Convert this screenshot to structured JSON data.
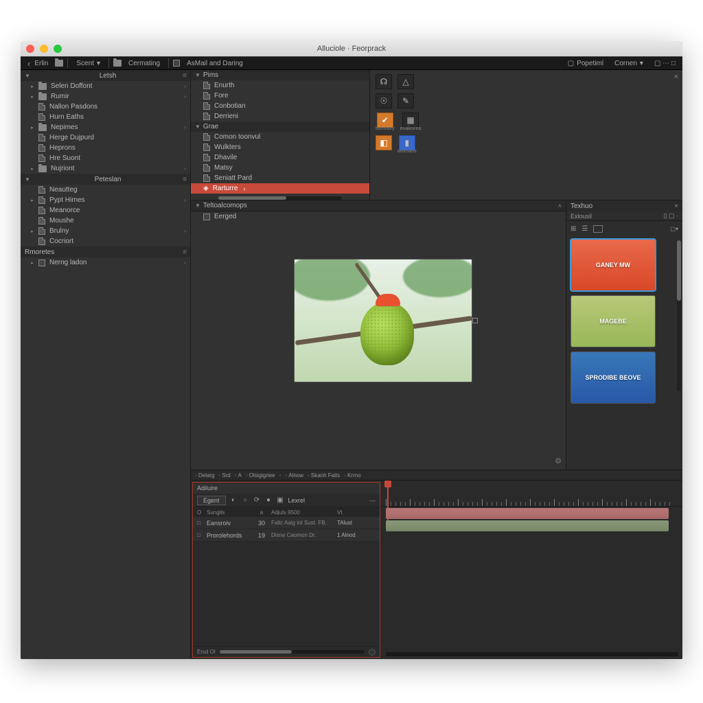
{
  "window_title": "Alluciole · Feorprack",
  "toolbar": {
    "back_label": "Erlin",
    "search_label": "Scent",
    "breadcrumb1": "Cermating",
    "breadcrumb2": "AsMail and Daring",
    "right1": "Popetiml",
    "right2": "Cornen"
  },
  "sidebar": {
    "sections": [
      {
        "title": "Letsh",
        "items": [
          {
            "label": "Selen Doffont",
            "icon": "folder",
            "expand": true
          },
          {
            "label": "Rumir",
            "icon": "folder",
            "expand": true
          },
          {
            "label": "Nallon Pasdons",
            "icon": "page"
          },
          {
            "label": "Hurn Eaths",
            "icon": "page"
          },
          {
            "label": "Nepimes",
            "icon": "folder",
            "expand": true
          },
          {
            "label": "Herge Dujpurd",
            "icon": "page"
          },
          {
            "label": "Heprons",
            "icon": "page"
          },
          {
            "label": "Hre Suont",
            "icon": "page"
          },
          {
            "label": "Nujriont",
            "icon": "folder",
            "expand": true
          }
        ]
      },
      {
        "title": "Peteslan",
        "items": [
          {
            "label": "Neautteg",
            "icon": "page"
          },
          {
            "label": "Pypt Hirnes",
            "icon": "page",
            "expand": true
          },
          {
            "label": "Meanorce",
            "icon": "page"
          },
          {
            "label": "Moushe",
            "icon": "page"
          },
          {
            "label": "Brulny",
            "icon": "page",
            "expand": true
          },
          {
            "label": "Cocriort",
            "icon": "page"
          }
        ]
      },
      {
        "title": "Rmoretes",
        "plain": true,
        "items": [
          {
            "label": "Nerng ladon",
            "icon": "sq",
            "expand": true
          }
        ]
      }
    ]
  },
  "plist": {
    "section1": {
      "title": "Pims",
      "items": [
        "Enurth",
        "Fore",
        "Conbotian",
        "Derrieni"
      ]
    },
    "section2": {
      "title": "Grae",
      "items": [
        "Comon toonvul",
        "Wulkters",
        "Dhavile",
        "Matsy",
        "Seniatt Pard"
      ],
      "selected": {
        "label": "Rarturre",
        "chev": "›"
      }
    }
  },
  "toolgrid": {
    "row3_labels": [
      "turmoury",
      "enalesrea"
    ],
    "row4_labels": [
      "",
      "wseoans"
    ]
  },
  "viewer": {
    "header": "Teltoalcomops",
    "item": "Eerged",
    "gear": "⚙"
  },
  "thumbs_panel": {
    "title": "Texhuo",
    "subtitle": "Exlousil",
    "items": [
      {
        "label": "GANEY MW",
        "cls": "t1",
        "sel": true
      },
      {
        "label": "MAGEBE",
        "cls": "t2"
      },
      {
        "label": "SPRODIBE BEOVE",
        "cls": "t3"
      }
    ]
  },
  "status": {
    "items": [
      "Delarg",
      "Srd",
      "A",
      "Olsigigriee",
      "",
      "Alnow",
      "Skanh  Faits",
      "Krrno"
    ]
  },
  "timeline": {
    "tab": "Adiluire",
    "head_btn": "Egent",
    "head_last": "Lexrel",
    "cols": [
      "O",
      "Sungils",
      "a",
      "Adjuls   9500",
      "Vt"
    ],
    "rows": [
      {
        "c1": "□",
        "c2": "Eansroiv",
        "c3": "30",
        "c4": "Faltc Aaig int Sust. FB.",
        "c5": "TAlust"
      },
      {
        "c1": "□",
        "c2": "Prorolehords",
        "c3": "19",
        "c4": "Disne Caomon Dr.",
        "c5": "1 Alnod"
      }
    ],
    "foot_label": "Ersd Ol"
  }
}
